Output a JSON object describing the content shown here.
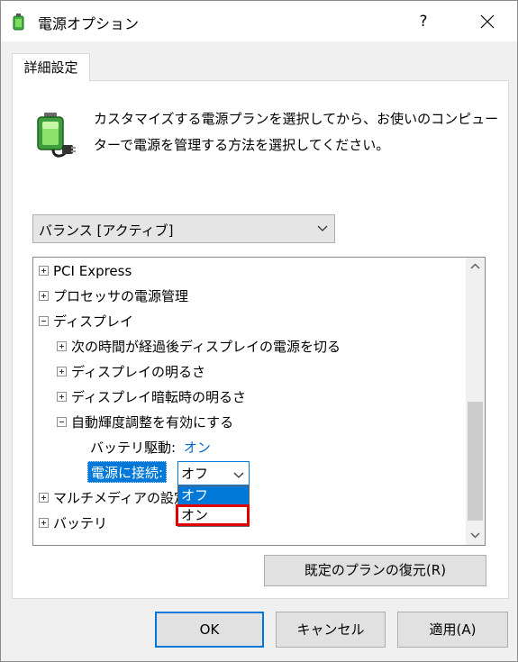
{
  "window": {
    "title": "電源オプション",
    "help_label": "?",
    "icons": {
      "app": "power-options-icon",
      "close": "close-icon"
    }
  },
  "tab": {
    "label": "詳細設定"
  },
  "description": {
    "line1": "カスタマイズする電源プランを選択してから、お使いのコンピュー",
    "line2": "ターで電源を管理する方法を選択してください。",
    "icon": "battery-plug-icon"
  },
  "plan_select": {
    "value": "バランス [アクティブ]",
    "icon": "chevron-down-icon"
  },
  "tree": {
    "items": [
      {
        "label": "PCI Express",
        "expander": "plus"
      },
      {
        "label": "プロセッサの電源管理",
        "expander": "plus"
      },
      {
        "label": "ディスプレイ",
        "expander": "minus"
      },
      {
        "label": "次の時間が経過後ディスプレイの電源を切る",
        "expander": "plus"
      },
      {
        "label": "ディスプレイの明るさ",
        "expander": "plus"
      },
      {
        "label": "ディスプレイ暗転時の明るさ",
        "expander": "plus"
      },
      {
        "label": "自動輝度調整を有効にする",
        "expander": "minus"
      },
      {
        "label": "マルチメディアの設定",
        "expander": "plus"
      },
      {
        "label": "バッテリ",
        "expander": "plus"
      }
    ],
    "battery_setting": {
      "label": "バッテリ駆動:",
      "value": "オン"
    },
    "plugged_setting": {
      "label": "電源に接続:",
      "value": "オフ",
      "options": [
        "オフ",
        "オン"
      ]
    }
  },
  "buttons": {
    "restore": "既定のプランの復元(R)",
    "ok": "OK",
    "cancel": "キャンセル",
    "apply": "適用(A)"
  },
  "colors": {
    "accent": "#0078d7",
    "highlight_box": "#e00000",
    "value_link": "#0066cc"
  }
}
